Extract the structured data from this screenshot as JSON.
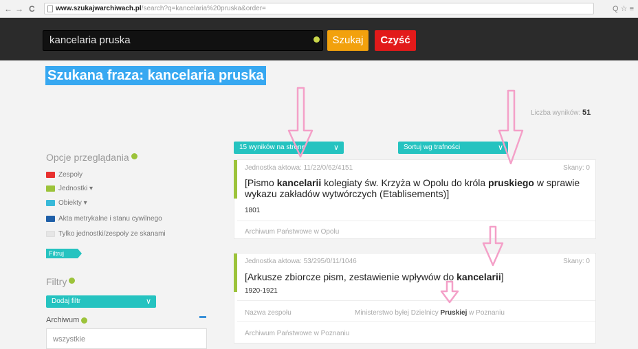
{
  "browser": {
    "back": "←",
    "forward": "→",
    "reload": "C",
    "url_host": "www.szukajwarchiwach.pl",
    "url_rest": "/search?q=kancelaria%20pruska&order=",
    "right_icons": "Q ☆ ≡"
  },
  "search": {
    "value": "kancelaria pruska",
    "submit_label": "Szukaj",
    "clear_label": "Czyść"
  },
  "heading": "Szukana fraza: kancelaria pruska",
  "results_count": {
    "label": "Liczba wyników:",
    "value": "51"
  },
  "sidebar": {
    "options_title": "Opcje przeglądania",
    "facets": [
      {
        "label": "Zespoły",
        "color": "#e8312f"
      },
      {
        "label": "Jednostki ▾",
        "color": "#9cc33a"
      },
      {
        "label": "Obiekty ▾",
        "color": "#38b9d9"
      },
      {
        "label": "Akta metrykalne i stanu cywilnego",
        "color": "#1f5fa8"
      },
      {
        "label": "Tylko jednostki/zespoły ze skanami",
        "color": "#e6e6e6"
      }
    ],
    "filter_button": "Filtruj",
    "filters_title": "Filtry",
    "add_filter": "Dodaj filtr",
    "archive_label": "Archiwum",
    "archive_value": "wszystkie"
  },
  "toolbar": {
    "per_page": "15 wyników na stronę",
    "sort": "Sortuj wg trafności"
  },
  "results": [
    {
      "signature": "Jednostka aktowa: 11/22/0/62/4151",
      "pages": "Skany: 0",
      "title_parts": [
        "[Pismo ",
        "kancelarii",
        " kolegiaty św. Krzyża w Opolu do króla ",
        "pruskiego",
        " w sprawie wykazu zakładów wytwórczych (Etablisements)]"
      ],
      "date": "1801",
      "archive": "Archiwum Państwowe w Opolu"
    },
    {
      "signature": "Jednostka aktowa: 53/295/0/11/1046",
      "pages": "Skany: 0",
      "title_parts": [
        "[Arkusze zbiorcze pism, zestawienie wpływów do ",
        "kancelarii",
        "]"
      ],
      "date": "1920-1921",
      "fond_label": "Nazwa zespołu",
      "fond_value_parts": [
        "Ministerstwo byłej Dzielnicy ",
        "Pruskiej",
        " w Poznaniu"
      ],
      "archive": "Archiwum Państwowe w Poznaniu"
    }
  ],
  "colors": {
    "accent_teal": "#25c3c0",
    "search_orange": "#f2a10d",
    "clear_red": "#e21a1a",
    "highlight_blue": "#37a8f1",
    "arrow_pink": "#f4a0c8"
  }
}
